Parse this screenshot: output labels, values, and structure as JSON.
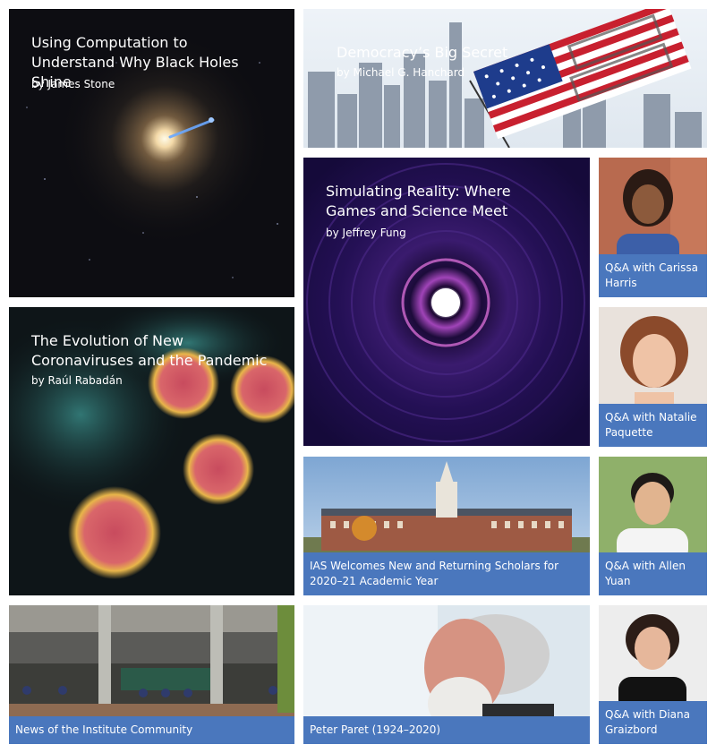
{
  "tiles": {
    "black_holes": {
      "title": "Using Computation to Understand Why Black Holes Shine",
      "byline": "by James Stone"
    },
    "democracy": {
      "title": "Democracy’s Big Secret",
      "byline": "by Michael G. Hanchard"
    },
    "simulating": {
      "title": "Simulating Reality: Where Games and Science Meet",
      "byline": "by Jeffrey Fung"
    },
    "carissa": {
      "caption": "Q&A with Carissa Harris"
    },
    "coronavirus": {
      "title": "The Evolution of New Coronaviruses and the Pandemic",
      "byline": "by Raúl Rabadán"
    },
    "natalie": {
      "caption": "Q&A with Natalie Paquette"
    },
    "ias_welcome": {
      "caption": "IAS Welcomes New and Returning Scholars for 2020–21 Academic Year"
    },
    "allen": {
      "caption": "Q&A with Allen Yuan"
    },
    "community": {
      "caption": "News of the Institute Community"
    },
    "paret": {
      "caption": "Peter Paret (1924–2020)"
    },
    "diana": {
      "caption": "Q&A with Diana Graizbord"
    }
  },
  "colors": {
    "caption_bg": "#4a77bd",
    "caption_text": "#ffffff"
  }
}
